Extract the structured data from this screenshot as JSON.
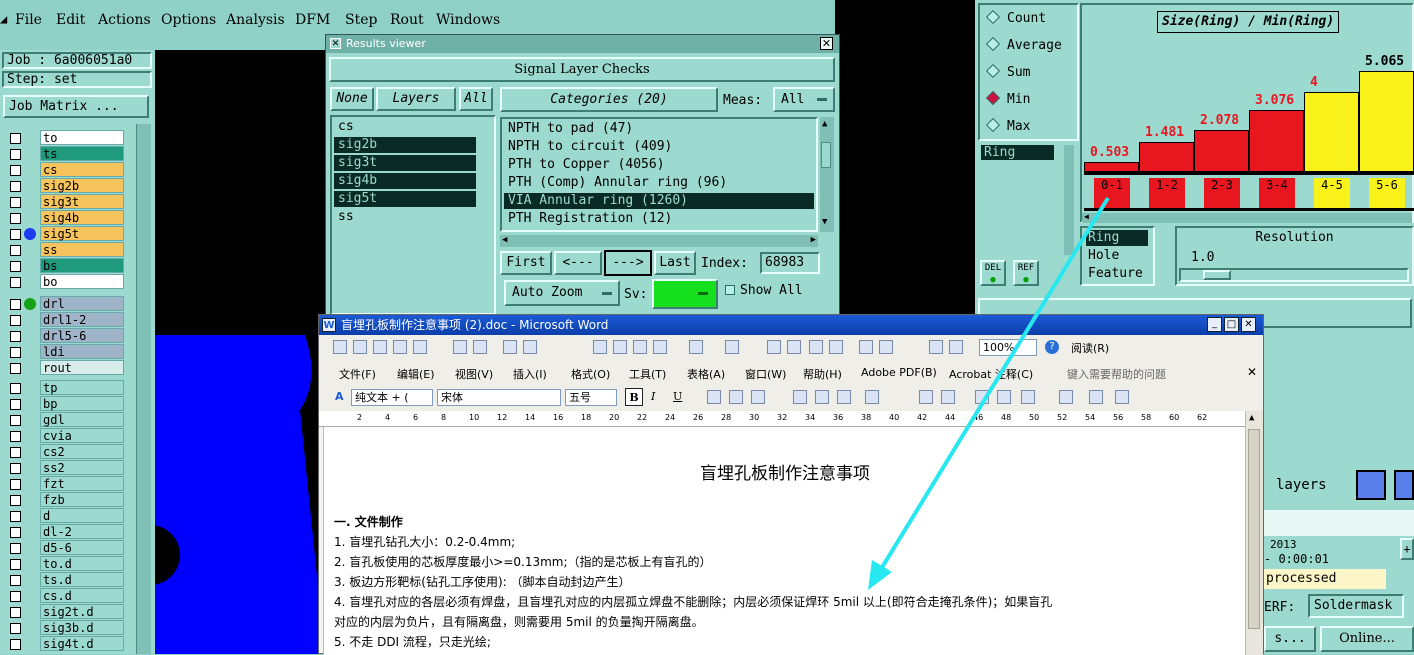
{
  "menu": [
    "File",
    "Edit",
    "Actions",
    "Options",
    "Analysis",
    "DFM",
    "Step",
    "Rout",
    "Windows"
  ],
  "left_panel": {
    "job": "Job : 6a006051a0",
    "step": "Step: set",
    "job_matrix": "Job Matrix ...",
    "layers_group1": [
      {
        "name": "to",
        "color": "#ffffff"
      },
      {
        "name": "ts",
        "color": "#1f9a7c"
      },
      {
        "name": "cs",
        "color": "#f7c35d"
      },
      {
        "name": "sig2b",
        "color": "#f7c35d"
      },
      {
        "name": "sig3t",
        "color": "#f7c35d"
      },
      {
        "name": "sig4b",
        "color": "#f7c35d"
      },
      {
        "name": "sig5t",
        "color": "#f7c35d"
      },
      {
        "name": "ss",
        "color": "#f7c35d"
      },
      {
        "name": "bs",
        "color": "#1f9a7c"
      },
      {
        "name": "bo",
        "color": "#ffffff"
      }
    ],
    "layers_group2": [
      "drl",
      "drl1-2",
      "drl5-6",
      "ldi",
      "rout"
    ],
    "layers_group3": [
      "tp",
      "bp",
      "gdl",
      "cvia",
      "cs2",
      "ss2",
      "fzt",
      "fzb",
      "d",
      "dl-2",
      "d5-6",
      "to.d",
      "ts.d",
      "cs.d",
      "sig2t.d",
      "sig3b.d",
      "sig4t.d"
    ]
  },
  "results_viewer": {
    "title": "Results viewer",
    "header": "Signal Layer Checks",
    "none_btn": "None",
    "layers_btn": "Layers",
    "all_btn": "All",
    "layers": [
      "cs",
      "sig2b",
      "sig3t",
      "sig4b",
      "sig5t",
      "ss"
    ],
    "categories_label": "Categories (20)",
    "meas_label": "Meas:",
    "meas_value": "All",
    "categories": [
      "NPTH to pad (47)",
      "NPTH to circuit (409)",
      "PTH to Copper (4056)",
      "PTH (Comp) Annular ring (96)",
      "VIA Annular ring (1260)",
      "PTH Registration (12)"
    ],
    "first_btn": "First",
    "prev_btn": "<---",
    "next_btn": "--->",
    "last_btn": "Last",
    "index_label": "Index:",
    "index_value": "68983",
    "auto_zoom": "Auto Zoom",
    "sv_label": "Sv:",
    "show_all": "Show All"
  },
  "stats_panel": {
    "options": [
      "Count",
      "Average",
      "Sum",
      "Min",
      "Max"
    ],
    "selected_option": "Min",
    "measure_field": "Ring",
    "del_btn": "DEL",
    "ref_btn": "REF",
    "chart_title": "Size(Ring) / Min(Ring)",
    "measure_list": [
      "Ring",
      "Hole",
      "Feature"
    ],
    "resolution_label": "Resolution",
    "resolution_value": "1.0"
  },
  "chart_data": {
    "type": "bar",
    "title": "Size(Ring) / Min(Ring)",
    "categories": [
      "0-1",
      "1-2",
      "2-3",
      "3-4",
      "4-5",
      "5-6"
    ],
    "values": [
      0.503,
      1.481,
      2.078,
      3.076,
      4,
      5.065
    ],
    "value_labels": [
      "0.503",
      "1.481",
      "2.078",
      "3.076",
      "4",
      "5.065"
    ],
    "colors": [
      "#e8161e",
      "#e8161e",
      "#e8161e",
      "#e8161e",
      "#f8f21a",
      "#f8f21a"
    ],
    "ylim": [
      0,
      5.5
    ]
  },
  "bottom_right": {
    "layers_label": "layers",
    "year_fragment": "2013",
    "time": "- 0:00:01",
    "processed": "processed",
    "erf": "ERF:",
    "soldermask": "Soldermask",
    "s_btn": "s...",
    "online_btn": "Online..."
  },
  "word": {
    "title": "盲埋孔板制作注意事项 (2).doc - Microsoft Word",
    "menus": [
      "文件(F)",
      "编辑(E)",
      "视图(V)",
      "插入(I)",
      "格式(O)",
      "工具(T)",
      "表格(A)",
      "窗口(W)",
      "帮助(H)",
      "Adobe PDF(B)",
      "Acrobat 注释(C)"
    ],
    "help_box": "键入需要帮助的问题",
    "zoom": "100%",
    "read_btn": "阅读(R)",
    "style_box": "纯文本 + (",
    "font_box": "宋体",
    "size_box": "五号",
    "ruler": [
      "2",
      "4",
      "6",
      "8",
      "10",
      "12",
      "14",
      "16",
      "18",
      "20",
      "22",
      "24",
      "26",
      "28",
      "30",
      "32",
      "34",
      "36",
      "38",
      "40",
      "42",
      "44",
      "46",
      "48",
      "50",
      "52",
      "54",
      "56",
      "58",
      "60",
      "62"
    ],
    "doc_title": "盲埋孔板制作注意事项",
    "section": "一. 文件制作",
    "items": [
      "1.  盲埋孔钻孔大小：0.2-0.4mm;",
      "2.  盲孔板使用的芯板厚度最小>=0.13mm;（指的是芯板上有盲孔的）",
      "3.  板边方形靶标(钻孔工序使用): （脚本自动封边产生）",
      "4.  盲埋孔对应的各层必须有焊盘，且盲埋孔对应的内层孤立焊盘不能删除；内层必须保证焊环 5mil 以上(即符合走掩孔条件)；如果盲孔",
      "     对应的内层为负片，且有隔离盘，则需要用 5mil 的负量掏开隔离盘。",
      "5.  不走 DDI 流程，只走光绘;"
    ]
  }
}
